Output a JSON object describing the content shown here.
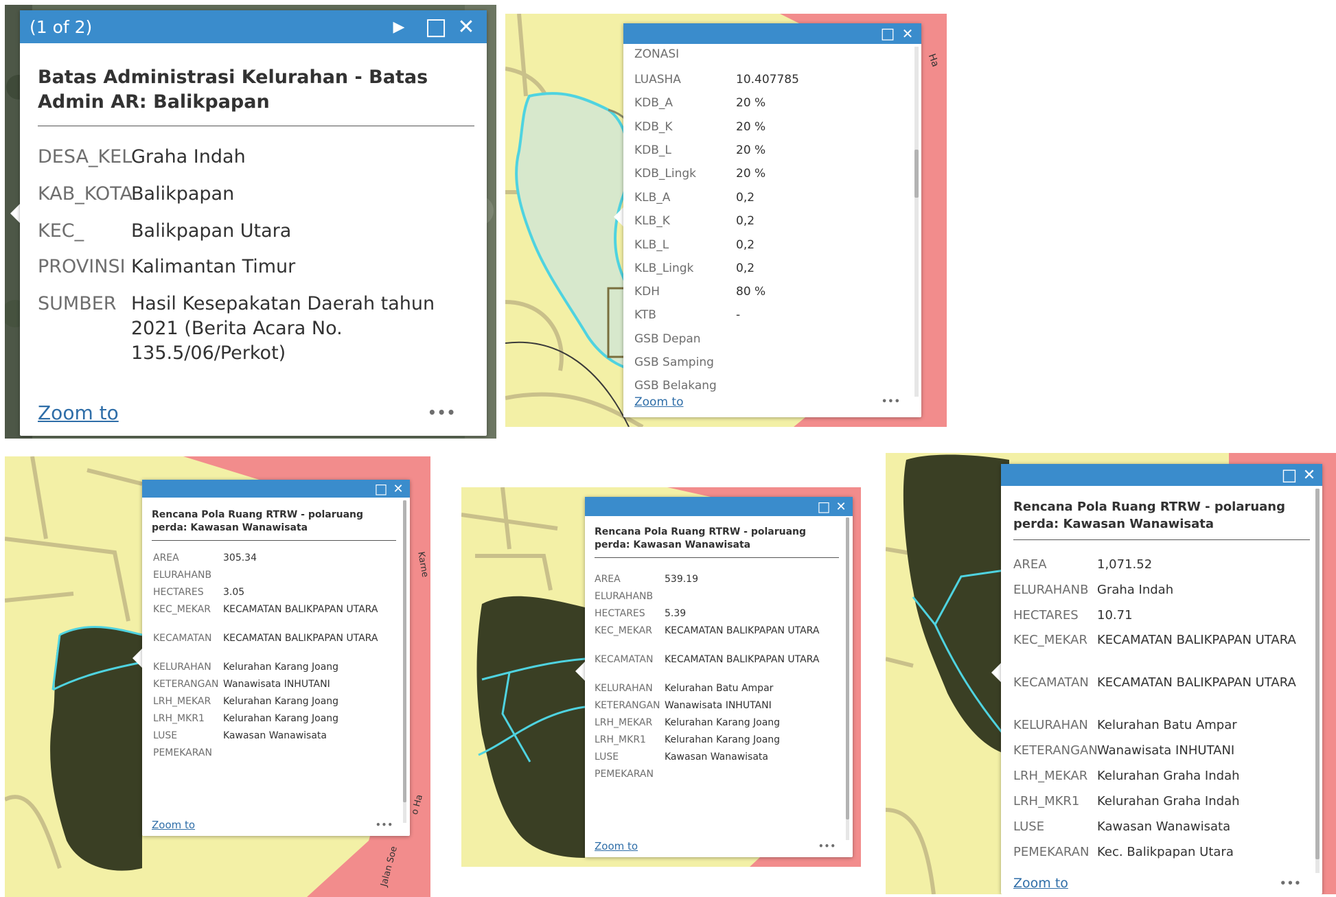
{
  "colors": {
    "header": "#3a8ccc",
    "map_yellow": "#f3f0a6",
    "map_red": "#f28c8c",
    "forest": "#3a3f24",
    "boundary": "#4fd3e0",
    "link": "#2f6ea8"
  },
  "icons": {
    "next": "play-triangle-icon",
    "maximize": "square-outline-icon",
    "close": "x-icon",
    "more": "ellipsis-icon"
  },
  "popup1": {
    "header_text": "(1 of 2)",
    "next_glyph": "▶",
    "maximize_glyph": "□",
    "close_glyph": "✕",
    "title": "Batas Administrasi Kelurahan - Batas Admin AR: Balikpapan",
    "rows": [
      {
        "key": "DESA_KEL",
        "value": "Graha Indah"
      },
      {
        "key": "KAB_KOTA",
        "value": "Balikpapan"
      },
      {
        "key": "KEC_",
        "value": "Balikpapan Utara"
      },
      {
        "key": "PROVINSI",
        "value": "Kalimantan Timur"
      },
      {
        "key": "SUMBER",
        "value": "Hasil Kesepakatan Daerah tahun 2021 (Berita Acara No. 135.5/06/Perkot)"
      }
    ],
    "zoom_label": "Zoom to",
    "more_glyph": "•••"
  },
  "popup2": {
    "maximize_glyph": "□",
    "close_glyph": "✕",
    "rows": [
      {
        "key": "ZONASI",
        "value": ""
      },
      {
        "key": "LUASHA",
        "value": "10.407785"
      },
      {
        "key": "KDB_A",
        "value": "20 %"
      },
      {
        "key": "KDB_K",
        "value": "20 %"
      },
      {
        "key": "KDB_L",
        "value": "20 %"
      },
      {
        "key": "KDB_Lingk",
        "value": "20 %"
      },
      {
        "key": "KLB_A",
        "value": "0,2"
      },
      {
        "key": "KLB_K",
        "value": "0,2"
      },
      {
        "key": "KLB_L",
        "value": "0,2"
      },
      {
        "key": "KLB_Lingk",
        "value": "0,2"
      },
      {
        "key": "KDH",
        "value": "80 %"
      },
      {
        "key": "KTB",
        "value": "-"
      },
      {
        "key": "GSB Depan",
        "value": ""
      },
      {
        "key": "GSB Samping",
        "value": ""
      },
      {
        "key": "GSB Belakang",
        "value": ""
      }
    ],
    "zoom_label": "Zoom to",
    "more_glyph": "•••"
  },
  "popup3": {
    "maximize_glyph": "□",
    "close_glyph": "✕",
    "title": "Rencana Pola Ruang RTRW - polaruang perda: Kawasan Wanawisata",
    "rows": [
      {
        "key": "AREA",
        "value": "305.34"
      },
      {
        "key": "ELURAHANB",
        "value": ""
      },
      {
        "key": "HECTARES",
        "value": "3.05"
      },
      {
        "key": "KEC_MEKAR",
        "value": "KECAMATAN BALIKPAPAN UTARA"
      },
      {
        "key": "KECAMATAN",
        "value": "KECAMATAN BALIKPAPAN UTARA"
      },
      {
        "key": "KELURAHAN",
        "value": "Kelurahan Karang Joang"
      },
      {
        "key": "KETERANGAN",
        "value": "Wanawisata INHUTANI"
      },
      {
        "key": "LRH_MEKAR",
        "value": "Kelurahan Karang Joang"
      },
      {
        "key": "LRH_MKR1",
        "value": "Kelurahan Karang Joang"
      },
      {
        "key": "LUSE",
        "value": "Kawasan Wanawisata"
      },
      {
        "key": "PEMEKARAN",
        "value": ""
      }
    ],
    "zoom_label": "Zoom to",
    "more_glyph": "•••"
  },
  "popup4": {
    "maximize_glyph": "□",
    "close_glyph": "✕",
    "title": "Rencana Pola Ruang RTRW - polaruang perda: Kawasan Wanawisata",
    "rows": [
      {
        "key": "AREA",
        "value": "539.19"
      },
      {
        "key": "ELURAHANB",
        "value": ""
      },
      {
        "key": "HECTARES",
        "value": "5.39"
      },
      {
        "key": "KEC_MEKAR",
        "value": "KECAMATAN BALIKPAPAN UTARA"
      },
      {
        "key": "KECAMATAN",
        "value": "KECAMATAN BALIKPAPAN UTARA"
      },
      {
        "key": "KELURAHAN",
        "value": "Kelurahan Batu Ampar"
      },
      {
        "key": "KETERANGAN",
        "value": "Wanawisata INHUTANI"
      },
      {
        "key": "LRH_MEKAR",
        "value": "Kelurahan Karang Joang"
      },
      {
        "key": "LRH_MKR1",
        "value": "Kelurahan Karang Joang"
      },
      {
        "key": "LUSE",
        "value": "Kawasan Wanawisata"
      },
      {
        "key": "PEMEKARAN",
        "value": ""
      }
    ],
    "zoom_label": "Zoom to",
    "more_glyph": "•••"
  },
  "popup5": {
    "maximize_glyph": "□",
    "close_glyph": "✕",
    "title": "Rencana Pola Ruang RTRW - polaruang perda: Kawasan Wanawisata",
    "rows": [
      {
        "key": "AREA",
        "value": "1,071.52"
      },
      {
        "key": "ELURAHANB",
        "value": "Graha Indah"
      },
      {
        "key": "HECTARES",
        "value": "10.71"
      },
      {
        "key": "KEC_MEKAR",
        "value": "KECAMATAN BALIKPAPAN UTARA"
      },
      {
        "key": "KECAMATAN",
        "value": "KECAMATAN BALIKPAPAN UTARA"
      },
      {
        "key": "KELURAHAN",
        "value": "Kelurahan Batu Ampar"
      },
      {
        "key": "KETERANGAN",
        "value": "Wanawisata INHUTANI"
      },
      {
        "key": "LRH_MEKAR",
        "value": "Kelurahan Graha Indah"
      },
      {
        "key": "LRH_MKR1",
        "value": "Kelurahan Graha Indah"
      },
      {
        "key": "LUSE",
        "value": "Kawasan Wanawisata"
      },
      {
        "key": "PEMEKARAN",
        "value": "Kec. Balikpapan Utara"
      }
    ],
    "zoom_label": "Zoom to",
    "more_glyph": "•••"
  },
  "map_labels": {
    "road_a": "Jalan Soe",
    "road_b": "o Ha",
    "road_c": "Karne",
    "road_d": "Jala",
    "road_e": "Ha"
  }
}
